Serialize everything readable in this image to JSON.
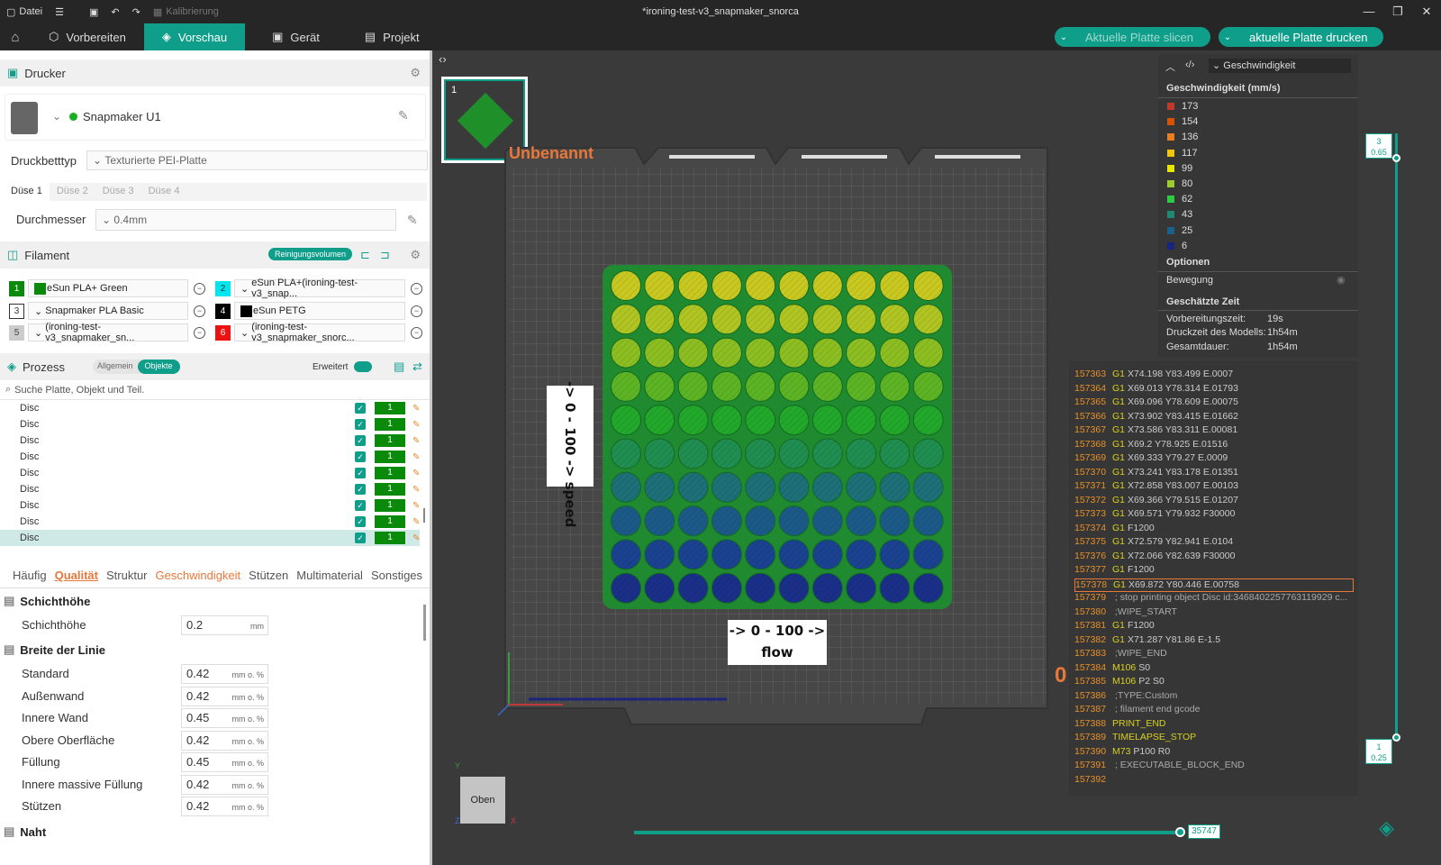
{
  "titlebar": {
    "file_menu": "Datei",
    "calibration": "Kalibrierung",
    "window_title": "*ironing-test-v3_snapmaker_snorca"
  },
  "topnav": {
    "tabs": [
      "Vorbereiten",
      "Vorschau",
      "Gerät",
      "Projekt"
    ],
    "active_tab": "Vorschau",
    "slice_button": "Aktuelle Platte slicen",
    "print_button": "aktuelle Platte drucken",
    "accent_color": "#0f9e8a"
  },
  "printer": {
    "section_title": "Drucker",
    "name": "Snapmaker U1",
    "bed_type_label": "Druckbetttyp",
    "bed_type_value": "Texturierte PEI-Platte",
    "nozzle_tabs": [
      "Düse 1",
      "Düse 2",
      "Düse 3",
      "Düse 4"
    ],
    "diameter_label": "Durchmesser",
    "diameter_value": "0.4mm"
  },
  "filament": {
    "section_title": "Filament",
    "purge_button": "Reinigungsvolumen",
    "slots": [
      {
        "num": "1",
        "name": "eSun PLA+ Green",
        "color": "#0a8a0a"
      },
      {
        "num": "2",
        "name": "eSun PLA+(ironing-test-v3_snap...",
        "color": "#00e5ee"
      },
      {
        "num": "3",
        "name": "Snapmaker PLA Basic",
        "color": "#ffffff"
      },
      {
        "num": "4",
        "name": "eSun PETG",
        "color": "#000000"
      },
      {
        "num": "5",
        "name": "(ironing-test-v3_snapmaker_sn...",
        "color": "#cccccc"
      },
      {
        "num": "6",
        "name": "(ironing-test-v3_snapmaker_snorc...",
        "color": "#ee1111"
      }
    ]
  },
  "process": {
    "section_title": "Prozess",
    "toggle_global": "Allgemein",
    "toggle_objects": "Objekte",
    "advanced_label": "Erweitert",
    "search_placeholder": "Suche Platte, Objekt und Teil.",
    "objects": [
      {
        "name": "Disc",
        "extruder": "1"
      },
      {
        "name": "Disc",
        "extruder": "1"
      },
      {
        "name": "Disc",
        "extruder": "1"
      },
      {
        "name": "Disc",
        "extruder": "1"
      },
      {
        "name": "Disc",
        "extruder": "1"
      },
      {
        "name": "Disc",
        "extruder": "1"
      },
      {
        "name": "Disc",
        "extruder": "1"
      },
      {
        "name": "Disc",
        "extruder": "1"
      },
      {
        "name": "Disc",
        "extruder": "1"
      }
    ],
    "tabs": [
      "Häufig",
      "Qualität",
      "Struktur",
      "Geschwindigkeit",
      "Stützen",
      "Multimaterial",
      "Sonstiges"
    ],
    "active_tab": "Qualität",
    "groups": {
      "layer_height": "Schichthöhe",
      "line_width": "Breite der Linie",
      "seam": "Naht"
    },
    "params": [
      {
        "label": "Schichthöhe",
        "value": "0.2",
        "unit": "mm"
      },
      {
        "label": "Standard",
        "value": "0.42",
        "unit": "mm o. %"
      },
      {
        "label": "Außenwand",
        "value": "0.42",
        "unit": "mm o. %"
      },
      {
        "label": "Innere Wand",
        "value": "0.45",
        "unit": "mm o. %"
      },
      {
        "label": "Obere Oberfläche",
        "value": "0.42",
        "unit": "mm o. %"
      },
      {
        "label": "Füllung",
        "value": "0.45",
        "unit": "mm o. %"
      },
      {
        "label": "Innere massive Füllung",
        "value": "0.42",
        "unit": "mm o. %"
      },
      {
        "label": "Stützen",
        "value": "0.42",
        "unit": "mm o. %"
      }
    ]
  },
  "viewport": {
    "plate_number": "1",
    "plate_name": "Unbenannt",
    "label_speed": "-> 0 - 100 -> speed",
    "label_flow_top": "-> 0 - 100 ->",
    "label_flow_bottom": "flow",
    "view_cube_label": "Oben",
    "axis_y": "Y",
    "axis_x": "X",
    "axis_z": "Z",
    "origin_marker": "0",
    "layer_slider_top": {
      "layer": "3",
      "height": "0.65"
    },
    "layer_slider_bottom": {
      "layer": "1",
      "height": "0.25"
    },
    "move_slider_value": "35747",
    "move_slider_fraction": 1.0
  },
  "legend": {
    "dropdown": "Geschwindigkeit",
    "title": "Geschwindigkeit (mm/s)",
    "entries": [
      {
        "value": "173",
        "color": "#c0392b"
      },
      {
        "value": "154",
        "color": "#d35400"
      },
      {
        "value": "136",
        "color": "#e67e22"
      },
      {
        "value": "117",
        "color": "#f1c40f"
      },
      {
        "value": "99",
        "color": "#e6e600"
      },
      {
        "value": "80",
        "color": "#9acd32"
      },
      {
        "value": "62",
        "color": "#2ecc40"
      },
      {
        "value": "43",
        "color": "#1f8a70"
      },
      {
        "value": "25",
        "color": "#1a5f8a"
      },
      {
        "value": "6",
        "color": "#1a237e"
      }
    ],
    "options_title": "Optionen",
    "option_move": "Bewegung",
    "time_title": "Geschätzte Zeit",
    "prep_label": "Vorbereitungszeit:",
    "prep_value": "19s",
    "model_label": "Druckzeit des Modells:",
    "model_value": "1h54m",
    "total_label": "Gesamtdauer:",
    "total_value": "1h54m"
  },
  "gcode": {
    "highlight_line": "157378",
    "lines": [
      {
        "n": "157363",
        "cmd": "G1",
        "args": "X74.198 Y83.499 E.0007"
      },
      {
        "n": "157364",
        "cmd": "G1",
        "args": "X69.013 Y78.314 E.01793"
      },
      {
        "n": "157365",
        "cmd": "G1",
        "args": "X69.096 Y78.609 E.00075"
      },
      {
        "n": "157366",
        "cmd": "G1",
        "args": "X73.902 Y83.415 E.01662"
      },
      {
        "n": "157367",
        "cmd": "G1",
        "args": "X73.586 Y83.311 E.00081"
      },
      {
        "n": "157368",
        "cmd": "G1",
        "args": "X69.2 Y78.925 E.01516"
      },
      {
        "n": "157369",
        "cmd": "G1",
        "args": "X69.333 Y79.27 E.0009"
      },
      {
        "n": "157370",
        "cmd": "G1",
        "args": "X73.241 Y83.178 E.01351"
      },
      {
        "n": "157371",
        "cmd": "G1",
        "args": "X72.858 Y83.007 E.00103"
      },
      {
        "n": "157372",
        "cmd": "G1",
        "args": "X69.366 Y79.515 E.01207"
      },
      {
        "n": "157373",
        "cmd": "G1",
        "args": "X69.571 Y79.932 F30000"
      },
      {
        "n": "157374",
        "cmd": "G1",
        "args": "F1200"
      },
      {
        "n": "157375",
        "cmd": "G1",
        "args": "X72.579 Y82.941 E.0104"
      },
      {
        "n": "157376",
        "cmd": "G1",
        "args": "X72.066 Y82.639 F30000"
      },
      {
        "n": "157377",
        "cmd": "G1",
        "args": "F1200"
      },
      {
        "n": "157378",
        "cmd": "G1",
        "args": "X69.872 Y80.446 E.00758"
      },
      {
        "n": "157379",
        "cmd": "",
        "args": "; stop printing object Disc id:3468402257763119929 c..."
      },
      {
        "n": "157380",
        "cmd": "",
        "args": ";WIPE_START"
      },
      {
        "n": "157381",
        "cmd": "G1",
        "args": "F1200"
      },
      {
        "n": "157382",
        "cmd": "G1",
        "args": "X71.287 Y81.86 E-1.5"
      },
      {
        "n": "157383",
        "cmd": "",
        "args": ";WIPE_END"
      },
      {
        "n": "157384",
        "cmd": "M106",
        "args": "S0"
      },
      {
        "n": "157385",
        "cmd": "M106",
        "args": "P2 S0"
      },
      {
        "n": "157386",
        "cmd": "",
        "args": ";TYPE:Custom"
      },
      {
        "n": "157387",
        "cmd": "",
        "args": "; filament end gcode"
      },
      {
        "n": "157388",
        "cmd": "PRINT_END",
        "args": ""
      },
      {
        "n": "157389",
        "cmd": "TIMELAPSE_STOP",
        "args": ""
      },
      {
        "n": "157390",
        "cmd": "M73",
        "args": "P100 R0"
      },
      {
        "n": "157391",
        "cmd": "",
        "args": "; EXECUTABLE_BLOCK_END"
      },
      {
        "n": "157392",
        "cmd": "",
        "args": ""
      }
    ]
  }
}
